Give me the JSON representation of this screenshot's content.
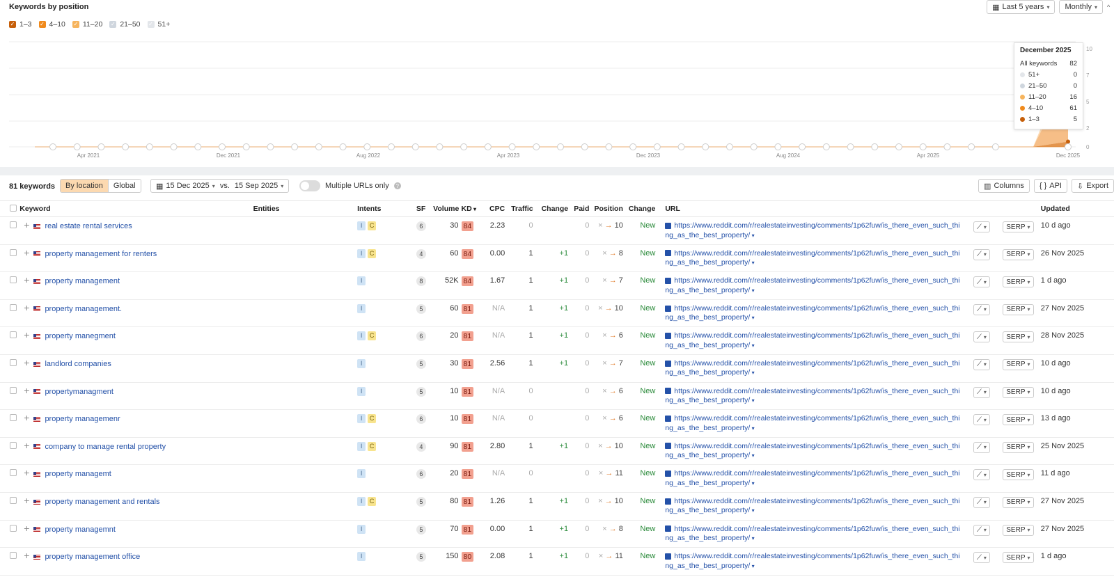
{
  "chart": {
    "title": "Keywords by position",
    "legend": [
      {
        "label": "1–3",
        "color": "#c65f0a",
        "checked": true
      },
      {
        "label": "4–10",
        "color": "#f08a1c",
        "checked": true
      },
      {
        "label": "11–20",
        "color": "#f6b45d",
        "checked": true
      },
      {
        "label": "21–50",
        "color": "#cfd6de",
        "checked": true
      },
      {
        "label": "51+",
        "color": "#e3e6ea",
        "checked": true
      }
    ],
    "period_label": "Last 5 years",
    "interval_label": "Monthly",
    "x_ticks": [
      "Apr 2021",
      "Dec 2021",
      "Aug 2022",
      "Apr 2023",
      "Dec 2023",
      "Aug 2024",
      "Apr 2025",
      "Dec 2025"
    ],
    "y_ticks_right": [
      "10",
      "7",
      "5",
      "2",
      "0"
    ],
    "tooltip": {
      "title": "December 2025",
      "rows": [
        {
          "label": "All keywords",
          "value": "82",
          "color": ""
        },
        {
          "label": "51+",
          "value": "0",
          "color": "#e3e6ea"
        },
        {
          "label": "21–50",
          "value": "0",
          "color": "#cfd6de"
        },
        {
          "label": "11–20",
          "value": "16",
          "color": "#f6b45d"
        },
        {
          "label": "4–10",
          "value": "61",
          "color": "#f08a1c"
        },
        {
          "label": "1–3",
          "value": "5",
          "color": "#c65f0a"
        }
      ]
    }
  },
  "chart_data": {
    "type": "area",
    "series_order": [
      "1–3",
      "4–10",
      "11–20",
      "21–50",
      "51+"
    ],
    "last_point": {
      "x": "Dec 2025",
      "1–3": 5,
      "4–10": 61,
      "11–20": 16,
      "21–50": 0,
      "51+": 0,
      "total": 82
    },
    "markers": [
      "G",
      "G",
      "G",
      "G",
      "G",
      "G",
      "G",
      "G",
      "G",
      "G",
      "G",
      "G",
      "G",
      "G",
      "G",
      "G",
      "G",
      "G",
      "G",
      "G",
      "G",
      "G",
      "G",
      "G",
      "G",
      "G",
      "G",
      "G",
      "G",
      "G",
      "G",
      "G",
      "G",
      "G",
      "G",
      "G",
      "G",
      "G",
      "G",
      "G",
      "G",
      "G",
      "G"
    ]
  },
  "toolbar": {
    "keyword_count": "81 keywords",
    "by_location": "By location",
    "global": "Global",
    "date_range": "15 Dec 2025",
    "vs": "vs.",
    "compare_date": "15 Sep 2025",
    "multiple_urls": "Multiple URLs only",
    "columns": "Columns",
    "api": "API",
    "export": "Export"
  },
  "table": {
    "headers": {
      "keyword": "Keyword",
      "entities": "Entities",
      "intents": "Intents",
      "sf": "SF",
      "volume": "Volume",
      "kd": "KD",
      "cpc": "CPC",
      "traffic": "Traffic",
      "change": "Change",
      "paid": "Paid",
      "position": "Position",
      "change2": "Change",
      "url": "URL",
      "updated": "Updated"
    },
    "serp_label": "SERP",
    "rows": [
      {
        "keyword": "real estate rental services",
        "intents": [
          "I",
          "C"
        ],
        "sf": "6",
        "volume": "30",
        "kd": "84",
        "cpc": "2.23",
        "traffic": "0",
        "change": "",
        "paid": "0",
        "pos_to": "10",
        "status": "New",
        "url": "https://www.reddit.com/r/realestateinvesting/comments/1p62fuw/is_there_even_such_thing_as_the_best_property/",
        "updated": "10 d ago"
      },
      {
        "keyword": "property management for renters",
        "intents": [
          "I",
          "C"
        ],
        "sf": "4",
        "volume": "60",
        "kd": "84",
        "cpc": "0.00",
        "traffic": "1",
        "change": "+1",
        "paid": "0",
        "pos_to": "8",
        "status": "New",
        "url": "https://www.reddit.com/r/realestateinvesting/comments/1p62fuw/is_there_even_such_thing_as_the_best_property/",
        "updated": "26 Nov 2025"
      },
      {
        "keyword": "property management",
        "intents": [
          "I"
        ],
        "sf": "8",
        "volume": "52K",
        "kd": "84",
        "cpc": "1.67",
        "traffic": "1",
        "change": "+1",
        "paid": "0",
        "pos_to": "7",
        "status": "New",
        "url": "https://www.reddit.com/r/realestateinvesting/comments/1p62fuw/is_there_even_such_thing_as_the_best_property/",
        "updated": "1 d ago"
      },
      {
        "keyword": "property management.",
        "intents": [
          "I"
        ],
        "sf": "5",
        "volume": "60",
        "kd": "81",
        "cpc": "N/A",
        "traffic": "1",
        "change": "+1",
        "paid": "0",
        "pos_to": "10",
        "status": "New",
        "url": "https://www.reddit.com/r/realestateinvesting/comments/1p62fuw/is_there_even_such_thing_as_the_best_property/",
        "updated": "27 Nov 2025"
      },
      {
        "keyword": "property manegment",
        "intents": [
          "I",
          "C"
        ],
        "sf": "6",
        "volume": "20",
        "kd": "81",
        "cpc": "N/A",
        "traffic": "1",
        "change": "+1",
        "paid": "0",
        "pos_to": "6",
        "status": "New",
        "url": "https://www.reddit.com/r/realestateinvesting/comments/1p62fuw/is_there_even_such_thing_as_the_best_property/",
        "updated": "28 Nov 2025"
      },
      {
        "keyword": "landlord companies",
        "intents": [
          "I"
        ],
        "sf": "5",
        "volume": "30",
        "kd": "81",
        "cpc": "2.56",
        "traffic": "1",
        "change": "+1",
        "paid": "0",
        "pos_to": "7",
        "status": "New",
        "url": "https://www.reddit.com/r/realestateinvesting/comments/1p62fuw/is_there_even_such_thing_as_the_best_property/",
        "updated": "10 d ago"
      },
      {
        "keyword": "propertymanagment",
        "intents": [
          "I"
        ],
        "sf": "5",
        "volume": "10",
        "kd": "81",
        "cpc": "N/A",
        "traffic": "0",
        "change": "",
        "paid": "0",
        "pos_to": "6",
        "status": "New",
        "url": "https://www.reddit.com/r/realestateinvesting/comments/1p62fuw/is_there_even_such_thing_as_the_best_property/",
        "updated": "10 d ago"
      },
      {
        "keyword": "property managemenr",
        "intents": [
          "I",
          "C"
        ],
        "sf": "6",
        "volume": "10",
        "kd": "81",
        "cpc": "N/A",
        "traffic": "0",
        "change": "",
        "paid": "0",
        "pos_to": "6",
        "status": "New",
        "url": "https://www.reddit.com/r/realestateinvesting/comments/1p62fuw/is_there_even_such_thing_as_the_best_property/",
        "updated": "13 d ago"
      },
      {
        "keyword": "company to manage rental property",
        "intents": [
          "I",
          "C"
        ],
        "sf": "4",
        "volume": "90",
        "kd": "81",
        "cpc": "2.80",
        "traffic": "1",
        "change": "+1",
        "paid": "0",
        "pos_to": "10",
        "status": "New",
        "url": "https://www.reddit.com/r/realestateinvesting/comments/1p62fuw/is_there_even_such_thing_as_the_best_property/",
        "updated": "25 Nov 2025"
      },
      {
        "keyword": "property managemt",
        "intents": [
          "I"
        ],
        "sf": "6",
        "volume": "20",
        "kd": "81",
        "cpc": "N/A",
        "traffic": "0",
        "change": "",
        "paid": "0",
        "pos_to": "11",
        "status": "New",
        "url": "https://www.reddit.com/r/realestateinvesting/comments/1p62fuw/is_there_even_such_thing_as_the_best_property/",
        "updated": "11 d ago"
      },
      {
        "keyword": "property management and rentals",
        "intents": [
          "I",
          "C"
        ],
        "sf": "5",
        "volume": "80",
        "kd": "81",
        "cpc": "1.26",
        "traffic": "1",
        "change": "+1",
        "paid": "0",
        "pos_to": "10",
        "status": "New",
        "url": "https://www.reddit.com/r/realestateinvesting/comments/1p62fuw/is_there_even_such_thing_as_the_best_property/",
        "updated": "27 Nov 2025"
      },
      {
        "keyword": "property managemnt",
        "intents": [
          "I"
        ],
        "sf": "5",
        "volume": "70",
        "kd": "81",
        "cpc": "0.00",
        "traffic": "1",
        "change": "+1",
        "paid": "0",
        "pos_to": "8",
        "status": "New",
        "url": "https://www.reddit.com/r/realestateinvesting/comments/1p62fuw/is_there_even_such_thing_as_the_best_property/",
        "updated": "27 Nov 2025"
      },
      {
        "keyword": "property management office",
        "intents": [
          "I"
        ],
        "sf": "5",
        "volume": "150",
        "kd": "80",
        "cpc": "2.08",
        "traffic": "1",
        "change": "+1",
        "paid": "0",
        "pos_to": "11",
        "status": "New",
        "url": "https://www.reddit.com/r/realestateinvesting/comments/1p62fuw/is_there_even_such_thing_as_the_best_property/",
        "updated": "1 d ago"
      }
    ]
  }
}
